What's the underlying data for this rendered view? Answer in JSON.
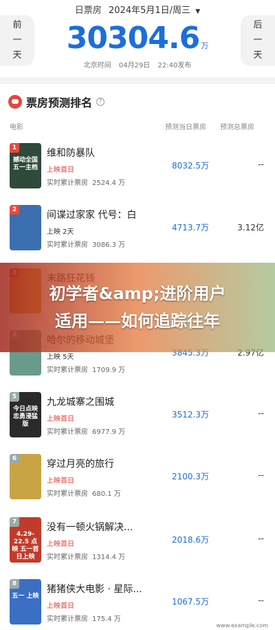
{
  "header": {
    "date_label": "日票房",
    "date": "2024年5月1日/周三",
    "prev_line1": "前",
    "prev_line2": "一",
    "prev_line3": "天",
    "next_line1": "后",
    "next_line2": "一",
    "next_line3": "天",
    "total": "30304.6",
    "total_unit": "万",
    "time_label": "北京时间",
    "time_date": "04月29日",
    "time_clock": "22:40发布"
  },
  "section": {
    "title": "票房预测排名",
    "info": "?",
    "col_movie": "电影",
    "col_pred_day": "预测当日票房",
    "col_pred_total": "预测总票房"
  },
  "rows": [
    {
      "rank": "1",
      "poster_text": "撼动全国 五一主档",
      "title": "维和防暴队",
      "status": "上映首日",
      "cum_label": "实时累计票房",
      "cum_value": "2524.4 万",
      "pred_day": "8032.5万",
      "pred_total": "--",
      "poster_color": "#2f4a3a"
    },
    {
      "rank": "2",
      "poster_text": "",
      "title": "间谍过家家 代号：白",
      "status": "上映 2天",
      "cum_label": "实时累计票房",
      "cum_value": "3086.3 万",
      "pred_day": "4713.7万",
      "pred_total": "3.12亿",
      "poster_color": "#3b6fb0"
    },
    {
      "rank": "3",
      "poster_text": "",
      "title": "末路狂花钱",
      "status": "",
      "cum_label": "",
      "cum_value": "",
      "pred_day": "4591.3万",
      "pred_total": "",
      "poster_color": "#d9962f"
    },
    {
      "rank": "4",
      "poster_text": "",
      "title": "哈尔的移动城堡",
      "status": "上映 5天",
      "cum_label": "实时累计票房",
      "cum_value": "1709.9 万",
      "pred_day": "3845.3万",
      "pred_total": "2.97亿",
      "poster_color": "#6a9a8c"
    },
    {
      "rank": "5",
      "poster_text": "今日点映 忠勇浸猛版",
      "title": "九龙城寨之围城",
      "status": "上映首日",
      "cum_label": "实时累计票房",
      "cum_value": "6977.9 万",
      "pred_day": "3512.3万",
      "pred_total": "--",
      "poster_color": "#2a2a2a"
    },
    {
      "rank": "6",
      "poster_text": "",
      "title": "穿过月亮的旅行",
      "status": "上映首日",
      "cum_label": "实时累计票房",
      "cum_value": "680.1 万",
      "pred_day": "2100.3万",
      "pred_total": "--",
      "poster_color": "#c9a445"
    },
    {
      "rank": "7",
      "poster_text": "4.29-22.5 点映 五一首日上映",
      "title": "没有一顿火锅解决...",
      "status": "上映首日",
      "cum_label": "实时累计票房",
      "cum_value": "1314.4 万",
      "pred_day": "2018.6万",
      "pred_total": "--",
      "poster_color": "#c23b2a"
    },
    {
      "rank": "8",
      "poster_text": "五一 上映",
      "title": "猪猪侠大电影 · 星际...",
      "status": "上映首日",
      "cum_label": "实时累计票房",
      "cum_value": "175.4 万",
      "pred_day": "1067.5万",
      "pred_total": "--",
      "poster_color": "#3a6fc4"
    }
  ],
  "overlay": {
    "line1": "初学者&amp;进阶用户",
    "line2": "适用——如何追踪往年"
  },
  "watermark": "www.example.com"
}
